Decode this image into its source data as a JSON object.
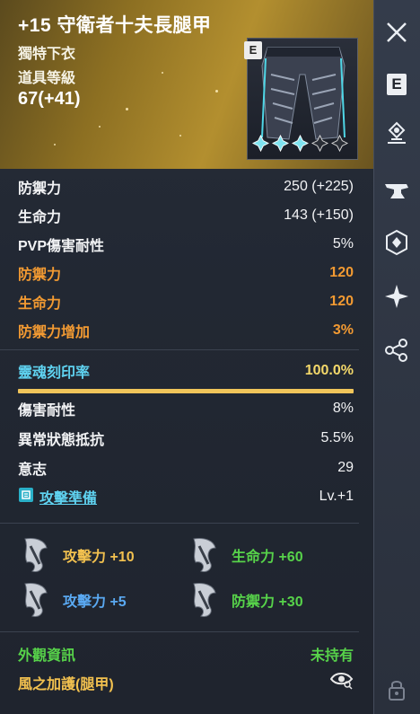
{
  "header": {
    "name": "+15 守衛者十夫長腿甲",
    "type": "獨特下衣",
    "level_label": "道具等級",
    "level": "67(+41)",
    "badge": "E",
    "enchant_stars": {
      "filled": 3,
      "total": 5
    }
  },
  "stats": [
    {
      "label": "防禦力",
      "value": "250 (+225)",
      "style": "white"
    },
    {
      "label": "生命力",
      "value": "143 (+150)",
      "style": "white"
    },
    {
      "label": "PVP傷害耐性",
      "value": "5%",
      "style": "white"
    },
    {
      "label": "防禦力",
      "value": "120",
      "style": "orange"
    },
    {
      "label": "生命力",
      "value": "120",
      "style": "orange"
    },
    {
      "label": "防禦力增加",
      "value": "3%",
      "style": "orange"
    }
  ],
  "soul": {
    "label": "靈魂刻印率",
    "value": "100.0%",
    "fill": 1.0
  },
  "extra_stats": [
    {
      "label": "傷害耐性",
      "value": "8%"
    },
    {
      "label": "異常狀態抵抗",
      "value": "5.5%"
    },
    {
      "label": "意志",
      "value": "29"
    }
  ],
  "skill": {
    "label": "攻擊準備",
    "value": "Lv.+1"
  },
  "buffs": [
    {
      "text": "攻擊力 +10",
      "color": "#f2c14f"
    },
    {
      "text": "生命力 +60",
      "color": "#57d34a"
    },
    {
      "text": "攻擊力 +5",
      "color": "#5aa9f2"
    },
    {
      "text": "防禦力 +30",
      "color": "#57d34a"
    }
  ],
  "footer": {
    "appearance_label": "外觀資訊",
    "appearance_value": "未持有",
    "wind_label": "風之加護(腿甲)"
  },
  "sidebar": {
    "e_label": "E"
  },
  "colors": {
    "accent_gold": "#f0c55a",
    "orange": "#f29a32",
    "cyan": "#5fd2f0"
  }
}
